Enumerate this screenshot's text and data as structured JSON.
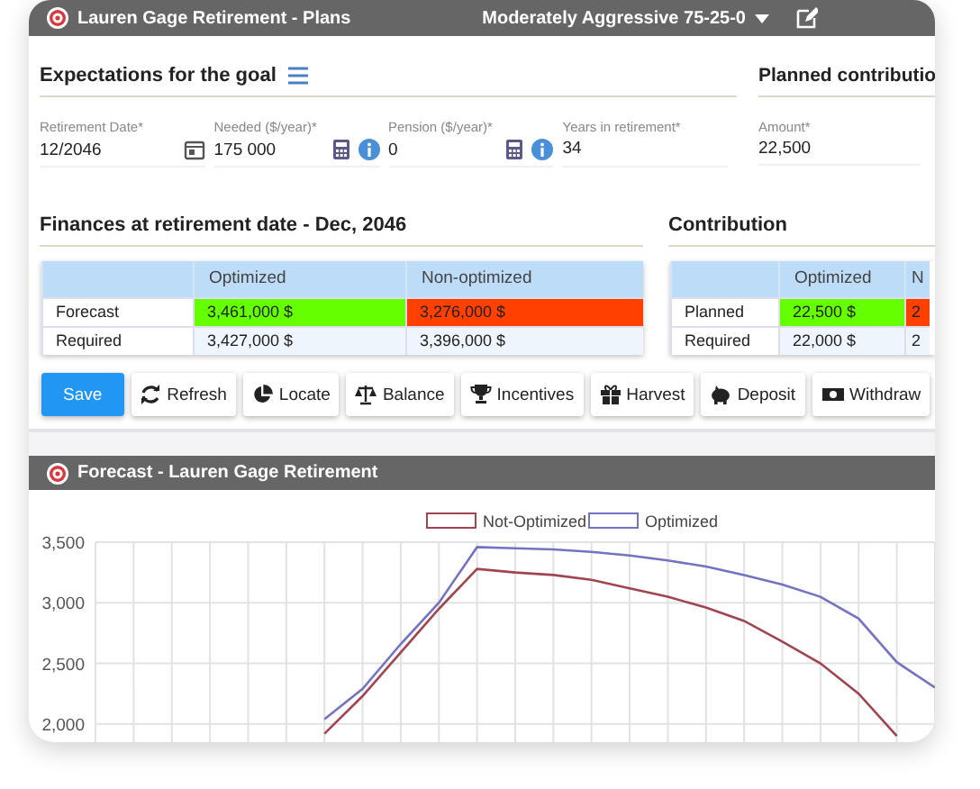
{
  "window": {
    "title": "Lauren Gage Retirement - Plans",
    "profile": "Moderately Aggressive 75-25-0"
  },
  "expectations": {
    "title": "Expectations for the goal",
    "fields": [
      {
        "label": "Retirement Date*",
        "value": "12/2046",
        "kind": "date"
      },
      {
        "label": "Needed ($/year)*",
        "value": "175 000",
        "kind": "calc"
      },
      {
        "label": "Pension ($/year)*",
        "value": "0",
        "kind": "calc"
      },
      {
        "label": "Years in retirement*",
        "value": "34",
        "kind": "plain"
      }
    ]
  },
  "planned": {
    "title": "Planned contributio",
    "fields": [
      {
        "label": "Amount*",
        "value": "22,500"
      }
    ]
  },
  "finances": {
    "title": "Finances at retirement date - Dec, 2046",
    "columns": [
      "Optimized",
      "Non-optimized"
    ],
    "rows": [
      {
        "label": "Forecast",
        "cells": [
          {
            "text": "3,461,000 $",
            "color": "#66ff00"
          },
          {
            "text": "3,276,000 $",
            "color": "#ff4000"
          }
        ]
      },
      {
        "label": "Required",
        "cells": [
          {
            "text": "3,427,000 $"
          },
          {
            "text": "3,396,000 $"
          }
        ]
      }
    ]
  },
  "contribution": {
    "title": "Contribution",
    "columns": [
      "Optimized",
      "N"
    ],
    "rows": [
      {
        "label": "Planned",
        "cells": [
          {
            "text": "22,500 $",
            "color": "#66ff00"
          },
          {
            "text": "2",
            "color": "#ff4000"
          }
        ]
      },
      {
        "label": "Required",
        "cells": [
          {
            "text": "22,000 $"
          },
          {
            "text": "2"
          }
        ]
      }
    ]
  },
  "buttons": [
    {
      "label": "Save",
      "kind": "primary"
    },
    {
      "label": "Refresh",
      "kind": "refresh"
    },
    {
      "label": "Locate",
      "kind": "pie"
    },
    {
      "label": "Balance",
      "kind": "scale"
    },
    {
      "label": "Incentives",
      "kind": "trophy"
    },
    {
      "label": "Harvest",
      "kind": "gift"
    },
    {
      "label": "Deposit",
      "kind": "piggy"
    },
    {
      "label": "Withdraw",
      "kind": "money"
    }
  ],
  "forecast": {
    "title": "Forecast - Lauren Gage Retirement",
    "chart_data": {
      "type": "line",
      "grid": true,
      "legend": true,
      "ylim": [
        1850,
        3500
      ],
      "yticks": [
        {
          "value": 2000,
          "label": "2,000"
        },
        {
          "value": 2500,
          "label": "2,500"
        },
        {
          "value": 3000,
          "label": "3,000"
        },
        {
          "value": 3500,
          "label": "3,500"
        }
      ],
      "series": [
        {
          "name": "Not-Optimized",
          "color": "#a04550",
          "values": [
            null,
            null,
            null,
            null,
            null,
            null,
            1920,
            2230,
            2590,
            2950,
            3280,
            3250,
            3230,
            3190,
            3120,
            3050,
            2960,
            2850,
            2680,
            2500,
            2250,
            1900,
            null
          ]
        },
        {
          "name": "Optimized",
          "color": "#7373c4",
          "values": [
            null,
            null,
            null,
            null,
            null,
            null,
            2040,
            2290,
            2660,
            3000,
            3460,
            3450,
            3440,
            3420,
            3390,
            3350,
            3300,
            3230,
            3150,
            3050,
            2870,
            2510,
            2300
          ]
        }
      ]
    }
  }
}
